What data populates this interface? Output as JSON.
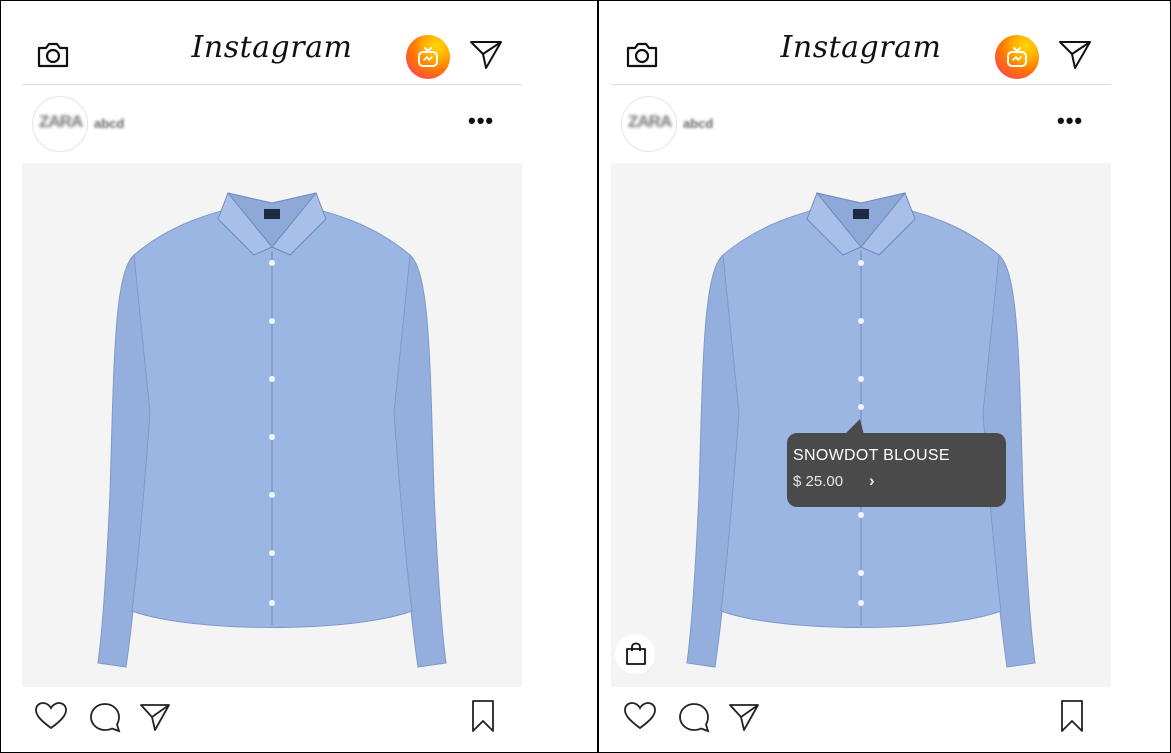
{
  "app": {
    "title": "Instagram"
  },
  "icons": {
    "camera": "camera-icon",
    "igtv": "igtv-icon",
    "direct": "paper-plane-icon",
    "more": "more-dots-icon",
    "like": "heart-icon",
    "comment": "comment-bubble-icon",
    "share": "paper-plane-icon",
    "save": "bookmark-icon",
    "shop": "shopping-bag-icon",
    "chevron": "chevron-right-icon"
  },
  "colors": {
    "igtv_gradient_start": "#ffd700",
    "igtv_gradient_end": "#ff2e6e",
    "tooltip_bg": "#4a4a4a",
    "shirt": "#9cb6e3"
  },
  "panels": [
    {
      "header": {
        "logo": "Instagram",
        "more": "•••"
      },
      "post": {
        "avatar_text": "ZARA",
        "username": "abcd"
      },
      "product_tag": null
    },
    {
      "header": {
        "logo": "Instagram",
        "more": "•••"
      },
      "post": {
        "avatar_text": "ZARA",
        "username": "abcd"
      },
      "product_tag": {
        "name": "SNOWDOT BLOUSE",
        "price": "$ 25.00",
        "chevron": "›"
      }
    }
  ]
}
